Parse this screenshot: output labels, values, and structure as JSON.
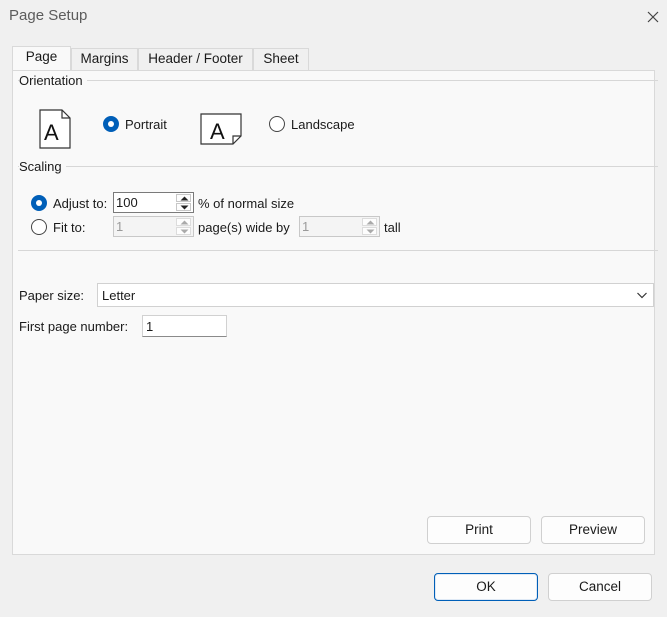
{
  "window": {
    "title": "Page Setup"
  },
  "tabs": [
    {
      "label": "Page",
      "active": true
    },
    {
      "label": "Margins"
    },
    {
      "label": "Header / Footer"
    },
    {
      "label": "Sheet"
    }
  ],
  "orientation": {
    "section_label": "Orientation",
    "portrait_label": "Portrait",
    "landscape_label": "Landscape",
    "selected": "Portrait"
  },
  "scaling": {
    "section_label": "Scaling",
    "adjust_label": "Adjust to:",
    "adjust_value": "100",
    "adjust_suffix": "% of normal size",
    "fit_label": "Fit to:",
    "fit_wide_value": "1",
    "fit_wide_suffix": "page(s) wide by",
    "fit_tall_value": "1",
    "fit_tall_suffix": "tall",
    "selected": "Adjust to"
  },
  "paper": {
    "size_label": "Paper size:",
    "size_value": "Letter",
    "first_page_label": "First page number:",
    "first_page_value": "1"
  },
  "buttons": {
    "print": "Print",
    "preview": "Preview",
    "ok": "OK",
    "cancel": "Cancel"
  },
  "colors": {
    "accent": "#005fb8"
  },
  "icons": [
    "close-icon",
    "portrait-page-icon",
    "landscape-page-icon",
    "chevron-down-icon",
    "spin-up-icon",
    "spin-down-icon"
  ]
}
